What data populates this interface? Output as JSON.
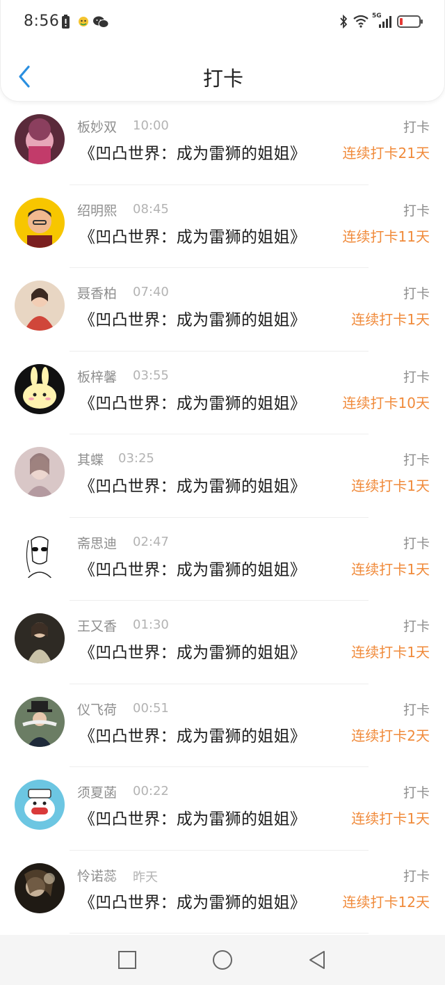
{
  "status_bar": {
    "time": "8:56",
    "network": "5G"
  },
  "header": {
    "title": "打卡"
  },
  "colors": {
    "accent": "#f08a3a",
    "back": "#2a8fe0",
    "text": "#1c1c1c",
    "muted": "#8e8e8e"
  },
  "items": [
    {
      "name": "板妙双",
      "time": "10:00",
      "book": "《凹凸世界：成为雷狮的姐姐》",
      "tag": "打卡",
      "streak": "连续打卡21天"
    },
    {
      "name": "绍明熙",
      "time": "08:45",
      "book": "《凹凸世界：成为雷狮的姐姐》",
      "tag": "打卡",
      "streak": "连续打卡11天"
    },
    {
      "name": "聂香柏",
      "time": "07:40",
      "book": "《凹凸世界：成为雷狮的姐姐》",
      "tag": "打卡",
      "streak": "连续打卡1天"
    },
    {
      "name": "板梓馨",
      "time": "03:55",
      "book": "《凹凸世界：成为雷狮的姐姐》",
      "tag": "打卡",
      "streak": "连续打卡10天"
    },
    {
      "name": "其蝶",
      "time": "03:25",
      "book": "《凹凸世界：成为雷狮的姐姐》",
      "tag": "打卡",
      "streak": "连续打卡1天"
    },
    {
      "name": "斋思迪",
      "time": "02:47",
      "book": "《凹凸世界：成为雷狮的姐姐》",
      "tag": "打卡",
      "streak": "连续打卡1天"
    },
    {
      "name": "王又香",
      "time": "01:30",
      "book": "《凹凸世界：成为雷狮的姐姐》",
      "tag": "打卡",
      "streak": "连续打卡1天"
    },
    {
      "name": "仪飞荷",
      "time": "00:51",
      "book": "《凹凸世界：成为雷狮的姐姐》",
      "tag": "打卡",
      "streak": "连续打卡2天"
    },
    {
      "name": "须夏菡",
      "time": "00:22",
      "book": "《凹凸世界：成为雷狮的姐姐》",
      "tag": "打卡",
      "streak": "连续打卡1天"
    },
    {
      "name": "怜诺蕊",
      "time": "昨天",
      "book": "《凹凸世界：成为雷狮的姐姐》",
      "tag": "打卡",
      "streak": "连续打卡12天"
    }
  ]
}
